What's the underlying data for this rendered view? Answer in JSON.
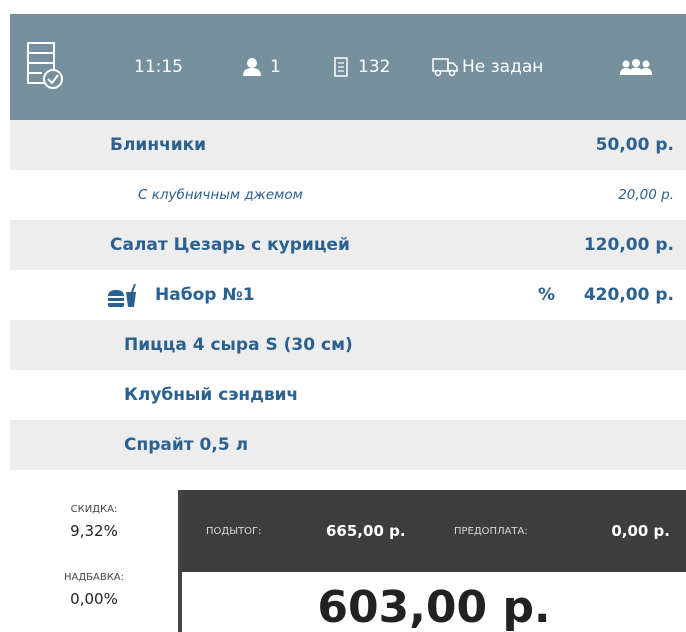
{
  "header": {
    "time": "11:15",
    "guests": "1",
    "order_number": "132",
    "delivery": "Не задан",
    "icons": [
      "order-check-icon",
      "person-icon",
      "receipt-icon",
      "delivery-truck-icon",
      "guests-group-icon"
    ]
  },
  "items": [
    {
      "name": "Блинчики",
      "price": "50,00 р."
    },
    {
      "name": "С клубничным джемом",
      "price": "20,00 р."
    },
    {
      "name": "Салат Цезарь с курицей",
      "price": "120,00 р."
    },
    {
      "name": "Набор №1",
      "discount": "%",
      "price": "420,00 р."
    },
    {
      "name": "Пицца 4 сыра S (30 см)"
    },
    {
      "name": "Клубный сэндвич"
    },
    {
      "name": "Спрайт 0,5 л"
    }
  ],
  "summary": {
    "discount_label": "СКИДКА:",
    "discount_value": "9,32%",
    "markup_label": "НАДБАВКА:",
    "markup_value": "0,00%",
    "subtotal_label": "ПОДЫТОГ:",
    "subtotal_value": "665,00 р.",
    "prepayment_label": "ПРЕДОПЛАТА:",
    "prepayment_value": "0,00 р.",
    "total": "603,00 р."
  },
  "colors": {
    "header_bg": "#77909d",
    "item_text": "#2a6191",
    "stripe": "#ededed",
    "summary_bg": "#3d3d3d"
  }
}
